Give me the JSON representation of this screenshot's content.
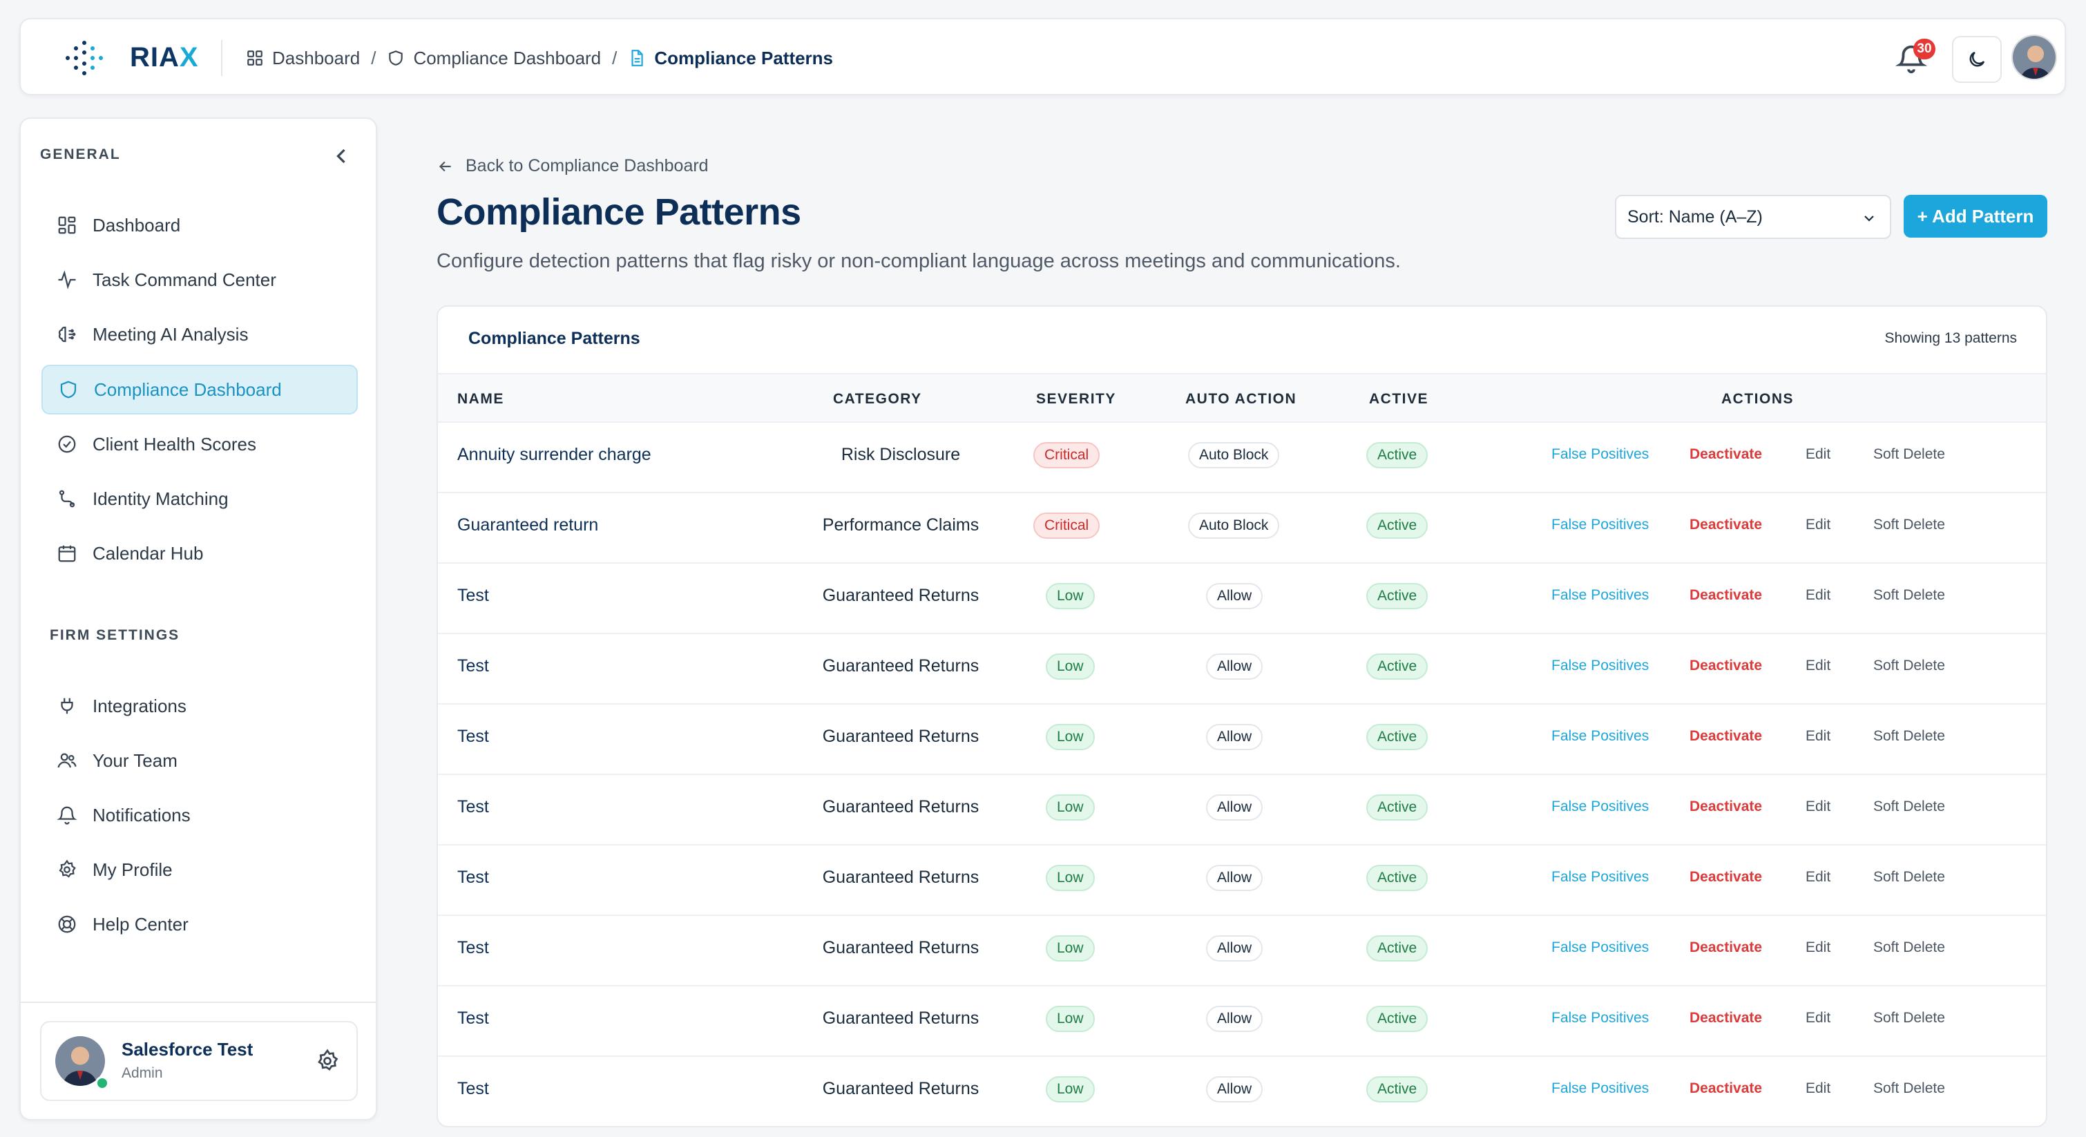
{
  "brand": {
    "name_main": "RIA",
    "name_accent": "X"
  },
  "breadcrumb": [
    {
      "label": "Dashboard",
      "icon": "grid-icon"
    },
    {
      "label": "Compliance Dashboard",
      "icon": "shield-icon"
    },
    {
      "label": "Compliance Patterns",
      "icon": "document-icon"
    }
  ],
  "header": {
    "notification_count": "30"
  },
  "sidebar": {
    "general_label": "GENERAL",
    "firm_label": "FIRM SETTINGS",
    "general_items": [
      {
        "label": "Dashboard",
        "icon": "grid-icon"
      },
      {
        "label": "Task Command Center",
        "icon": "activity-icon"
      },
      {
        "label": "Meeting AI Analysis",
        "icon": "brain-icon"
      },
      {
        "label": "Compliance Dashboard",
        "icon": "shield-icon",
        "active": true
      },
      {
        "label": "Client Health Scores",
        "icon": "check-circle-icon"
      },
      {
        "label": "Identity Matching",
        "icon": "route-icon"
      },
      {
        "label": "Calendar Hub",
        "icon": "calendar-icon"
      }
    ],
    "firm_items": [
      {
        "label": "Integrations",
        "icon": "plug-icon"
      },
      {
        "label": "Your Team",
        "icon": "users-icon"
      },
      {
        "label": "Notifications",
        "icon": "bell-icon"
      },
      {
        "label": "My Profile",
        "icon": "gear-icon"
      },
      {
        "label": "Help Center",
        "icon": "lifebuoy-icon"
      }
    ],
    "user": {
      "name": "Salesforce Test",
      "role": "Admin"
    }
  },
  "main": {
    "back_label": "Back to Compliance Dashboard",
    "title": "Compliance Patterns",
    "subtitle": "Configure detection patterns that flag risky or non-compliant language across meetings and communications.",
    "sort_value": "Sort: Name (A–Z)",
    "add_label": "+ Add Pattern"
  },
  "table": {
    "title": "Compliance Patterns",
    "count_label": "Showing 13 patterns",
    "columns": {
      "name": "NAME",
      "category": "CATEGORY",
      "severity": "SEVERITY",
      "auto_action": "AUTO ACTION",
      "active": "ACTIVE",
      "actions": "ACTIONS"
    },
    "action_labels": {
      "fp": "False Positives",
      "deactivate": "Deactivate",
      "edit": "Edit",
      "soft_delete": "Soft Delete"
    },
    "rows": [
      {
        "name": "Annuity surrender charge",
        "category": "Risk Disclosure",
        "severity": "Critical",
        "auto_action": "Auto Block",
        "active": "Active"
      },
      {
        "name": "Guaranteed return",
        "category": "Performance Claims",
        "severity": "Critical",
        "auto_action": "Auto Block",
        "active": "Active"
      },
      {
        "name": "Test",
        "category": "Guaranteed Returns",
        "severity": "Low",
        "auto_action": "Allow",
        "active": "Active"
      },
      {
        "name": "Test",
        "category": "Guaranteed Returns",
        "severity": "Low",
        "auto_action": "Allow",
        "active": "Active"
      },
      {
        "name": "Test",
        "category": "Guaranteed Returns",
        "severity": "Low",
        "auto_action": "Allow",
        "active": "Active"
      },
      {
        "name": "Test",
        "category": "Guaranteed Returns",
        "severity": "Low",
        "auto_action": "Allow",
        "active": "Active"
      },
      {
        "name": "Test",
        "category": "Guaranteed Returns",
        "severity": "Low",
        "auto_action": "Allow",
        "active": "Active"
      },
      {
        "name": "Test",
        "category": "Guaranteed Returns",
        "severity": "Low",
        "auto_action": "Allow",
        "active": "Active"
      },
      {
        "name": "Test",
        "category": "Guaranteed Returns",
        "severity": "Low",
        "auto_action": "Allow",
        "active": "Active"
      },
      {
        "name": "Test",
        "category": "Guaranteed Returns",
        "severity": "Low",
        "auto_action": "Allow",
        "active": "Active"
      }
    ]
  },
  "colors": {
    "brand_navy": "#0d3566",
    "accent": "#1ca6db",
    "danger": "#dc3b3b",
    "success": "#1e7d46"
  }
}
